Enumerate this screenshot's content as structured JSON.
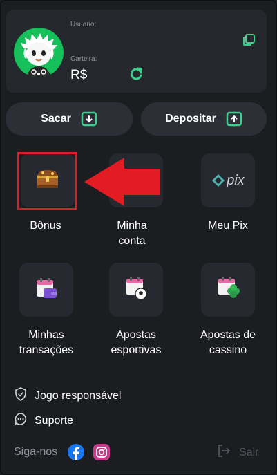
{
  "profile": {
    "usuario_label": "Usuario:",
    "carteira_label": "Carteira:",
    "balance": "R$"
  },
  "actions": {
    "sacar": "Sacar",
    "depositar": "Depositar"
  },
  "menu": {
    "bonus": "Bônus",
    "minha_conta_1": "Minha",
    "minha_conta_2": "conta",
    "meu_pix": "Meu Pix",
    "pix_logo": "pix",
    "transacoes_1": "Minhas",
    "transacoes_2": "transações",
    "esportivas_1": "Apostas",
    "esportivas_2": "esportivas",
    "cassino_1": "Apostas de",
    "cassino_2": "cassino"
  },
  "links": {
    "jogo_responsavel": "Jogo responsável",
    "suporte": "Suporte",
    "siga_nos": "Siga-nos",
    "sair": "Sair"
  },
  "colors": {
    "accent_green": "#3ecf8e",
    "highlight_red": "#e31b23"
  },
  "icons": [
    "avatar",
    "copy-icon",
    "refresh-icon",
    "withdraw-icon",
    "deposit-icon",
    "treasure-chest-icon",
    "pix-logo-icon",
    "wallet-calendar-icon",
    "soccer-calendar-icon",
    "clover-calendar-icon",
    "shield-check-icon",
    "chat-icon",
    "facebook-icon",
    "instagram-icon",
    "logout-icon",
    "red-arrow"
  ]
}
